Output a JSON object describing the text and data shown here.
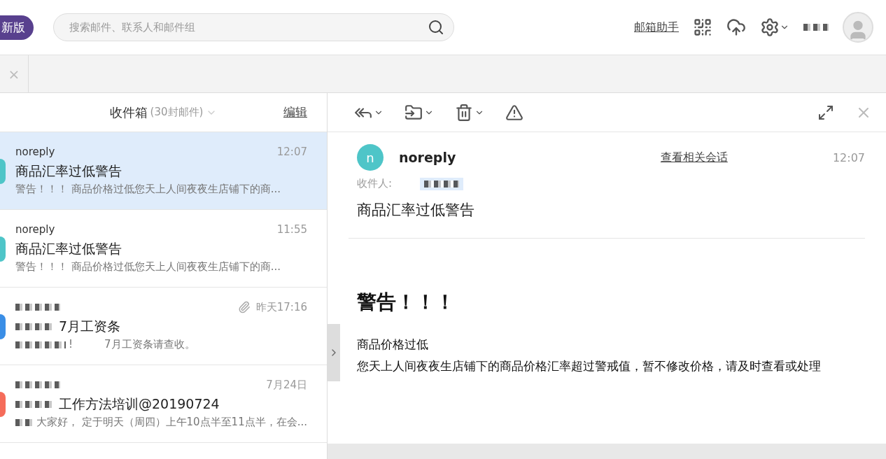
{
  "header": {
    "badge": "新版",
    "search": {
      "placeholder": "搜索邮件、联系人和邮件组"
    },
    "assistant_link": "邮箱助手"
  },
  "tabbar": {
    "close": "×"
  },
  "mail_list": {
    "folder": "收件箱",
    "count": "(30封邮件)",
    "edit": "编辑",
    "items": [
      {
        "sender": "noreply",
        "time": "12:07",
        "subject": "商品汇率过低警告",
        "preview": "警告！！！ 商品价格过低您天上人间夜夜生店铺下的商...",
        "selected": true,
        "color": "#4ec5c8",
        "attachment": false
      },
      {
        "sender": "noreply",
        "time": "11:55",
        "subject": "商品汇率过低警告",
        "preview": "警告！！！ 商品价格过低您天上人间夜夜生店铺下的商...",
        "selected": false,
        "color": "#4ec5c8",
        "attachment": false
      },
      {
        "time": "昨天17:16",
        "subject": "7月工资条",
        "preview": "!　　　7月工资条请查收。",
        "selected": false,
        "color": "#3a8ee6",
        "attachment": true
      },
      {
        "time": "7月24日",
        "subject": "工作方法培训@20190724",
        "preview": "大家好， 定于明天（周四）上午10点半至11点半，在会...",
        "selected": false,
        "color": "#f56c5a",
        "attachment": false
      }
    ]
  },
  "reader": {
    "sender_initial": "n",
    "sender": "noreply",
    "related_link": "查看相关会话",
    "time": "12:07",
    "to_label": "收件人:",
    "subject": "商品汇率过低警告",
    "heading": "警告！！！",
    "paragraphs": [
      "商品价格过低",
      "您天上人间夜夜生店铺下的商品价格汇率超过警戒值，暂不修改价格，请及时查看或处理"
    ]
  }
}
